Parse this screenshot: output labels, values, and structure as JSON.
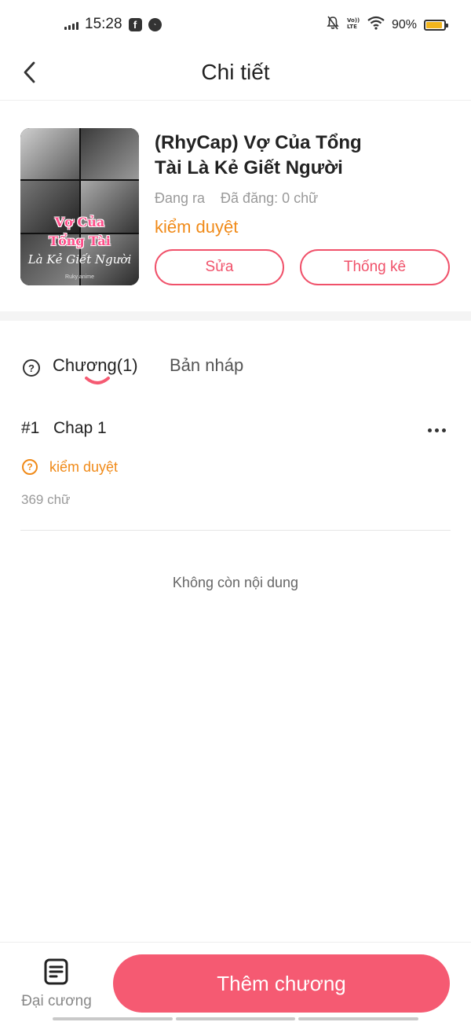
{
  "status_bar": {
    "time": "15:28",
    "battery_percent": "90%",
    "battery_level": 0.9,
    "left_icons": [
      "signal-icon",
      "facebook-icon",
      "messenger-icon"
    ],
    "right_icons": [
      "mute-icon",
      "volte-icon",
      "wifi-icon",
      "battery-icon"
    ],
    "volte_label": "VoLTE"
  },
  "header": {
    "title": "Chi tiết",
    "back_icon": "chevron-left-icon"
  },
  "book": {
    "title": "(RhyCap) Vợ Của Tổng Tài Là Kẻ Giết Người",
    "status": "Đang ra",
    "published": "Đã đăng: 0 chữ",
    "review_status": "kiểm duyệt",
    "cover": {
      "line1": "Vợ Của",
      "line2": "Tổng Tài",
      "line3": "Là Kẻ Giết Người",
      "credit": "Ruky anime"
    },
    "edit_label": "Sửa",
    "stats_label": "Thống kê"
  },
  "tabs": {
    "help_icon": "question-circle-icon",
    "chapters_label": "Chương(1)",
    "drafts_label": "Bản nháp"
  },
  "chapters": [
    {
      "number": "#1",
      "name": "Chap 1",
      "status": "kiểm duyệt",
      "words": "369 chữ"
    }
  ],
  "empty_text": "Không còn nội dung",
  "bottom_bar": {
    "outline_label": "Đại cương",
    "outline_icon": "document-list-icon",
    "add_chapter_label": "Thêm chương"
  },
  "colors": {
    "accent": "#f55a72",
    "accent_outline": "#f0516a",
    "warning": "#f08a18",
    "battery": "#f2b51d"
  }
}
